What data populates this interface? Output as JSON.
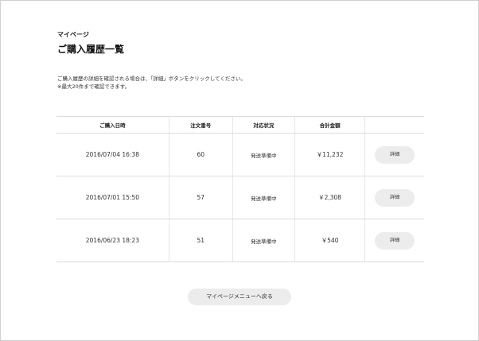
{
  "header": {
    "breadcrumb": "マイページ",
    "title": "ご購入履歴一覧"
  },
  "description": {
    "line1": "ご購入履歴の詳細を確認される場合は、「詳細」ボタンをクリックしてください。",
    "line2": "※最大20件まで確認できます。"
  },
  "table": {
    "headers": [
      "ご購入日時",
      "注文番号",
      "対応状況",
      "合計金額",
      ""
    ],
    "rows": [
      {
        "date": "2016/07/04 16:38",
        "order_no": "60",
        "status": "発送準備中",
        "total": "￥11,232",
        "action": "詳細"
      },
      {
        "date": "2016/07/01 15:50",
        "order_no": "57",
        "status": "発送準備中",
        "total": "￥2,308",
        "action": "詳細"
      },
      {
        "date": "2016/06/23 18:23",
        "order_no": "51",
        "status": "発送準備中",
        "total": "￥540",
        "action": "詳細"
      }
    ]
  },
  "footer": {
    "back_label": "マイページメニューへ戻る"
  }
}
